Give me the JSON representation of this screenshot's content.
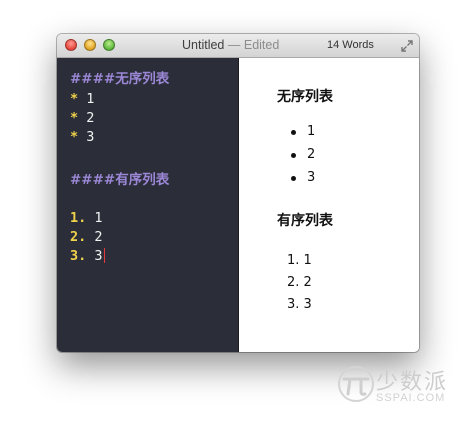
{
  "window": {
    "title": "Untitled",
    "separator": "—",
    "status": "Edited",
    "word_count": "14 Words"
  },
  "editor": {
    "unordered_heading": "####无序列表",
    "unordered_items": [
      {
        "marker": "*",
        "text": "1"
      },
      {
        "marker": "*",
        "text": "2"
      },
      {
        "marker": "*",
        "text": "3"
      }
    ],
    "ordered_heading": "####有序列表",
    "ordered_items": [
      {
        "marker": "1.",
        "text": "1"
      },
      {
        "marker": "2.",
        "text": "2"
      },
      {
        "marker": "3.",
        "text": "3"
      }
    ]
  },
  "preview": {
    "unordered_heading": "无序列表",
    "unordered_items": [
      "1",
      "2",
      "3"
    ],
    "ordered_heading": "有序列表",
    "ordered_items": [
      {
        "number": "1.",
        "text": "1"
      },
      {
        "number": "2.",
        "text": "2"
      },
      {
        "number": "3.",
        "text": "3"
      }
    ]
  },
  "watermark": {
    "brand": "少数派",
    "domain": "SSPAI.COM"
  },
  "colors": {
    "editor_bg": "#2b2e38",
    "heading_source": "#9b87d6",
    "list_marker": "#f0d24b",
    "cursor": "#e23b3b"
  }
}
